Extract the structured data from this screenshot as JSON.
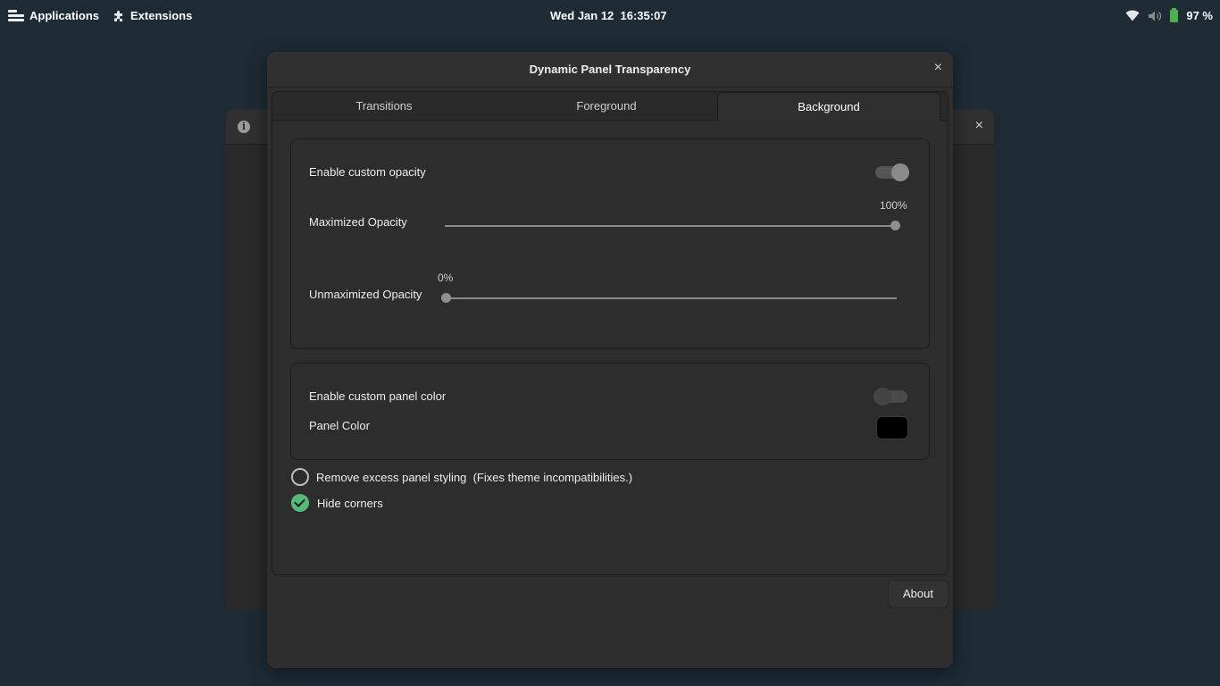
{
  "topbar": {
    "applications_label": "Applications",
    "extensions_label": "Extensions",
    "clock": "Wed Jan 12  16:35:07",
    "battery_percent": "97 %"
  },
  "dialog": {
    "title": "Dynamic Panel Transparency",
    "close_glyph": "×"
  },
  "background_window": {
    "info_glyph": "i",
    "close_glyph": "×"
  },
  "tabs": [
    {
      "label": "Transitions"
    },
    {
      "label": "Foreground"
    },
    {
      "label": "Background",
      "active": true
    }
  ],
  "opacity_section": {
    "enable_label": "Enable custom opacity",
    "enable_on": true,
    "maximized_label": "Maximized Opacity",
    "maximized_value_text": "100%",
    "maximized_value": 100,
    "unmaximized_label": "Unmaximized Opacity",
    "unmaximized_value_text": "0%",
    "unmaximized_value": 0
  },
  "color_section": {
    "enable_label": "Enable custom panel color",
    "enable_on": false,
    "panel_color_label": "Panel Color",
    "panel_color": "#000000"
  },
  "options": {
    "remove_styling_label": "Remove excess panel styling  (Fixes theme incompatibilities.)",
    "remove_styling_checked": false,
    "hide_corners_label": "Hide corners",
    "hide_corners_checked": true
  },
  "about_label": "About",
  "colors": {
    "desktop": "#1e2b35",
    "accent_green": "#57b97a",
    "battery_green": "#4caf50"
  }
}
